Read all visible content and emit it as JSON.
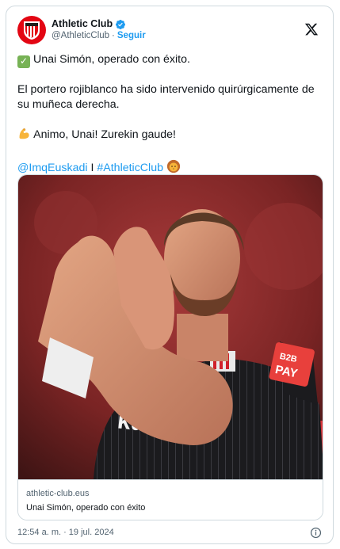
{
  "account": {
    "name": "Athletic Club",
    "handle": "@AthleticClub",
    "separator": "·",
    "follow_label": "Seguir"
  },
  "tweet": {
    "line1": "Unai Simón, operado con éxito.",
    "line2": "El portero rojiblanco ha sido intervenido quirúrgicamente de su muñeca derecha.",
    "line3": "Animo, Unai! Zurekin gaude!",
    "mention": "@ImqEuskadi",
    "divider": "I",
    "hashtag": "#AthleticClub"
  },
  "link_card": {
    "domain": "athletic-club.eus",
    "title": "Unai Simón, operado con éxito"
  },
  "timestamp": "12:54 a. m. · 19 jul. 2024",
  "photo_text": {
    "sponsor": "kutxa",
    "patch_line1": "B2B",
    "patch_line2": "PAY"
  },
  "colors": {
    "brand_red": "#e30613",
    "link_blue": "#1d9bf0",
    "muted": "#536471"
  },
  "icons": [
    "club-crest-icon",
    "verified-badge-icon",
    "x-logo-icon",
    "check-mark-emoji",
    "flexed-biceps-emoji",
    "lion-emoji",
    "info-icon"
  ]
}
